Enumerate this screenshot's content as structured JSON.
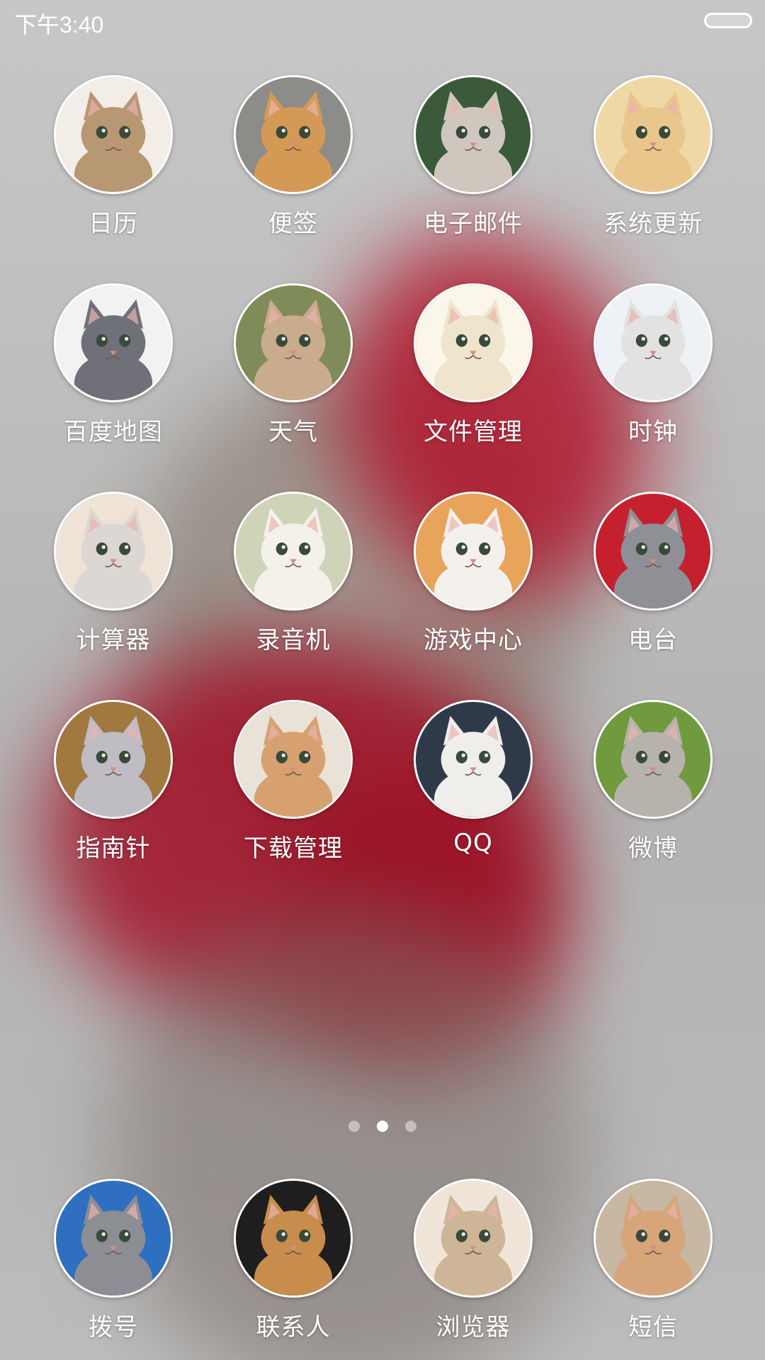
{
  "status_bar": {
    "time": "下午3:40"
  },
  "apps": [
    {
      "label": "日历",
      "icon": "calico-kitten-icon",
      "fur": "#b89773",
      "bg": "#f2ede6"
    },
    {
      "label": "便签",
      "icon": "orange-kitten-car-icon",
      "fur": "#d49a55",
      "bg": "#8c8c88"
    },
    {
      "label": "电子邮件",
      "icon": "grey-kitten-icon",
      "fur": "#cfc7be",
      "bg": "#3b5a3a"
    },
    {
      "label": "系统更新",
      "icon": "cream-kitten-basket-icon",
      "fur": "#e9c78c",
      "bg": "#f0d8a6"
    },
    {
      "label": "百度地图",
      "icon": "grey-kitten-icon",
      "fur": "#707078",
      "bg": "#f2f2f2"
    },
    {
      "label": "天气",
      "icon": "tan-kitten-icon",
      "fur": "#c9ab8d",
      "bg": "#7f8b58"
    },
    {
      "label": "文件管理",
      "icon": "mustache-kitten-icon",
      "fur": "#efe4cc",
      "bg": "#fbf6ea"
    },
    {
      "label": "时钟",
      "icon": "white-kitten-red-cape-icon",
      "fur": "#e2e2e2",
      "bg": "#eef2f6"
    },
    {
      "label": "计算器",
      "icon": "white-kitten-toy-icon",
      "fur": "#dcd7d2",
      "bg": "#efe2d6"
    },
    {
      "label": "录音机",
      "icon": "white-persian-kitten-icon",
      "fur": "#f3f1ea",
      "bg": "#cfd3b8"
    },
    {
      "label": "游戏中心",
      "icon": "black-white-kitten-icon",
      "fur": "#f4f0ec",
      "bg": "#e7a45a"
    },
    {
      "label": "电台",
      "icon": "tabby-kitten-red-hood-icon",
      "fur": "#8f9096",
      "bg": "#c4202e"
    },
    {
      "label": "指南针",
      "icon": "kitten-in-basket-icon",
      "fur": "#bfbcc4",
      "bg": "#a07840"
    },
    {
      "label": "下载管理",
      "icon": "kitten-straw-hat-icon",
      "fur": "#d6a070",
      "bg": "#e9e2d8"
    },
    {
      "label": "QQ",
      "icon": "upside-down-kitten-ball-icon",
      "fur": "#efeeea",
      "bg": "#2e3a4a"
    },
    {
      "label": "微博",
      "icon": "kitten-on-grass-icon",
      "fur": "#b8b2ac",
      "bg": "#6f9a3e"
    }
  ],
  "page_indicator": {
    "count": 3,
    "active": 2
  },
  "dock": [
    {
      "label": "拨号",
      "icon": "grey-kitten-blue-blanket-icon",
      "fur": "#8d8d94",
      "bg": "#2f6fbf"
    },
    {
      "label": "联系人",
      "icon": "bengal-kitten-black-hat-icon",
      "fur": "#c88c4c",
      "bg": "#1e1e1e"
    },
    {
      "label": "浏览器",
      "icon": "tabby-kitten-closeup-icon",
      "fur": "#cfb598",
      "bg": "#efe6d9"
    },
    {
      "label": "短信",
      "icon": "ginger-kitten-icon",
      "fur": "#d6a57a",
      "bg": "#c7b7a3"
    }
  ]
}
